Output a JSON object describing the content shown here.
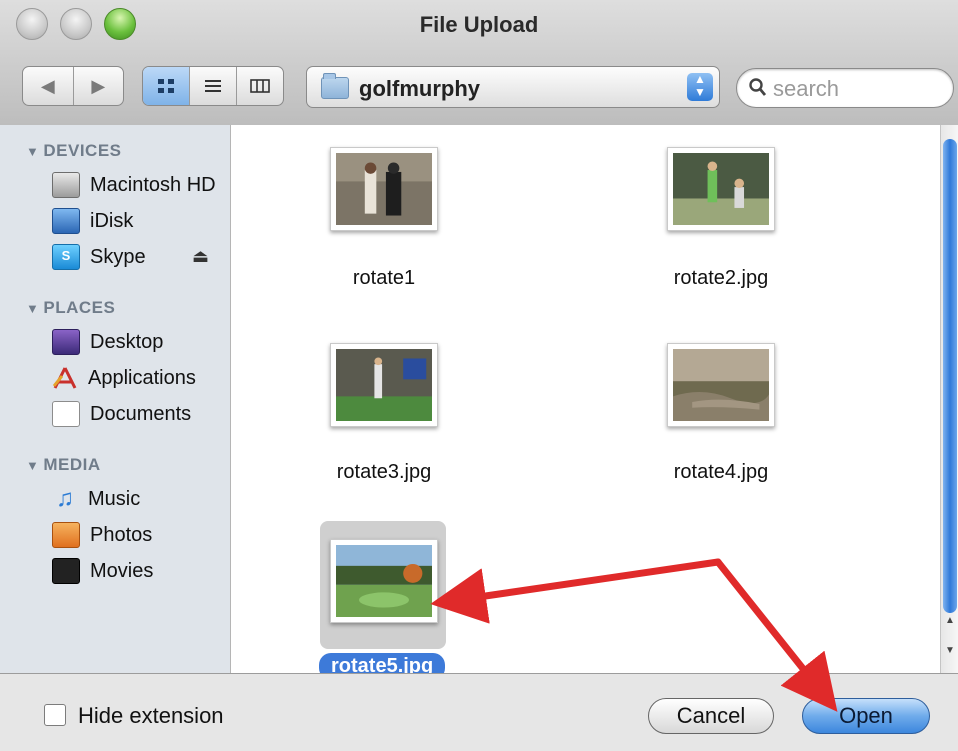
{
  "window": {
    "title": "File Upload"
  },
  "toolbar": {
    "back_glyph": "◀",
    "forward_glyph": "▶",
    "view_icons": [
      "icon-view-icon",
      "list-view-icon",
      "column-view-icon"
    ],
    "path_popup": {
      "label": "golfmurphy"
    },
    "search": {
      "placeholder": "search"
    }
  },
  "sidebar": {
    "sections": [
      {
        "header": "DEVICES",
        "items": [
          {
            "label": "Macintosh HD",
            "icon": "hard-drive-icon"
          },
          {
            "label": "iDisk",
            "icon": "idisk-icon"
          },
          {
            "label": "Skype",
            "icon": "skype-icon",
            "eject": true
          }
        ]
      },
      {
        "header": "PLACES",
        "items": [
          {
            "label": "Desktop",
            "icon": "desktop-icon"
          },
          {
            "label": "Applications",
            "icon": "applications-icon"
          },
          {
            "label": "Documents",
            "icon": "documents-icon"
          }
        ]
      },
      {
        "header": "MEDIA",
        "items": [
          {
            "label": "Music",
            "icon": "music-icon"
          },
          {
            "label": "Photos",
            "icon": "photos-icon"
          },
          {
            "label": "Movies",
            "icon": "movies-icon"
          }
        ]
      }
    ]
  },
  "files": [
    {
      "name": "rotate1",
      "selected": false
    },
    {
      "name": "rotate2.jpg",
      "selected": false
    },
    {
      "name": "rotate3.jpg",
      "selected": false
    },
    {
      "name": "rotate4.jpg",
      "selected": false
    },
    {
      "name": "rotate5.jpg",
      "selected": true
    }
  ],
  "footer": {
    "hide_extension_label": "Hide extension",
    "hide_extension_checked": false,
    "cancel_label": "Cancel",
    "open_label": "Open"
  },
  "colors": {
    "selection": "#3d7ad9",
    "annotation_arrow": "#e02a2a",
    "default_button": "#3c87dd"
  }
}
